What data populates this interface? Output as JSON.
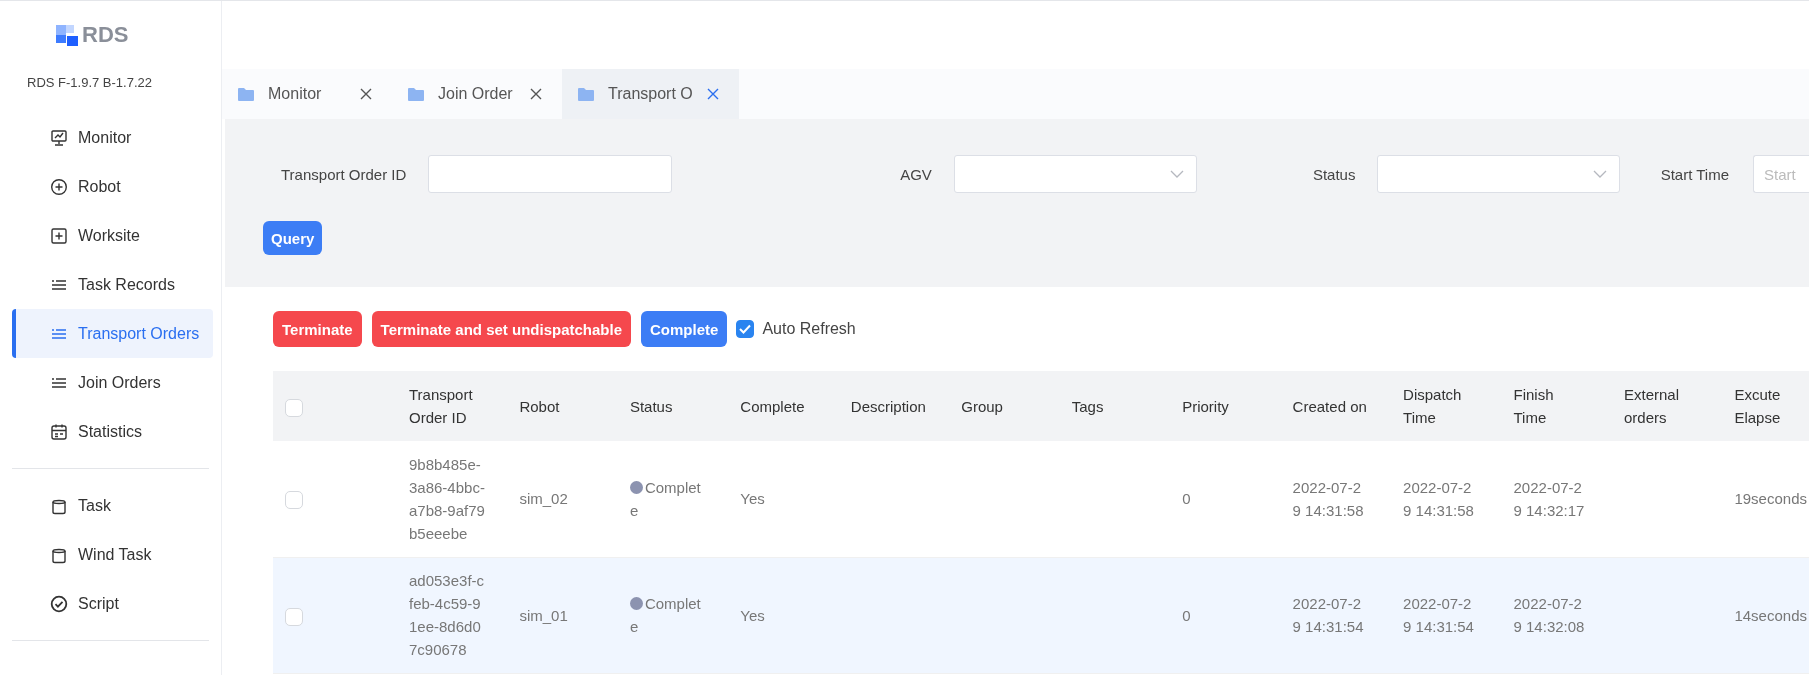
{
  "sidebar": {
    "logo": "RDS",
    "version": "RDS F-1.9.7 B-1.7.22",
    "groups": [
      [
        {
          "label": "Monitor",
          "kind": "monitor",
          "selected": false
        },
        {
          "label": "Robot",
          "kind": "addcircle",
          "selected": false
        },
        {
          "label": "Worksite",
          "kind": "addsquare",
          "selected": false
        },
        {
          "label": "Task Records",
          "kind": "list",
          "selected": false
        },
        {
          "label": "Transport Orders",
          "kind": "list",
          "selected": true
        },
        {
          "label": "Join Orders",
          "kind": "list",
          "selected": false
        },
        {
          "label": "Statistics",
          "kind": "calendar",
          "selected": false
        }
      ],
      [
        {
          "label": "Task",
          "kind": "storage",
          "selected": false
        },
        {
          "label": "Wind Task",
          "kind": "storage",
          "selected": false
        },
        {
          "label": "Script",
          "kind": "check",
          "selected": false
        }
      ]
    ]
  },
  "tabs": [
    {
      "label": "Monitor",
      "selected": false
    },
    {
      "label": "Join Order",
      "selected": false
    },
    {
      "label": "Transport O",
      "selected": true
    }
  ],
  "filters": [
    {
      "label": "Transport Order ID",
      "kind": "text"
    },
    {
      "label": "AGV",
      "kind": "select"
    },
    {
      "label": "Status",
      "kind": "select"
    },
    {
      "label": "Start Time",
      "kind": "date",
      "placeholder": "Start"
    }
  ],
  "query_button": "Query",
  "actions": [
    {
      "label": "Terminate",
      "kind": "danger"
    },
    {
      "label": "Terminate and set undispatchable",
      "kind": "danger"
    },
    {
      "label": "Complete",
      "kind": "primary"
    }
  ],
  "auto_refresh": {
    "label": "Auto Refresh",
    "checked": true
  },
  "table": {
    "select_all": {
      "checked": false
    },
    "columns": [
      "Transport Order ID",
      "Robot",
      "Status",
      "Complete",
      "Description",
      "Group",
      "Tags",
      "Priority",
      "Created on",
      "Dispatch Time",
      "Finish Time",
      "External orders",
      "Excute Elapse"
    ],
    "rows": [
      {
        "selected": false,
        "checked": false,
        "cells": [
          "9b8b485e-3a86-4bbc-a7b8-9af79b5eeebe",
          "sim_02",
          {
            "text": "Complete",
            "color": "#8c93b0"
          },
          "Yes",
          "",
          "",
          "",
          "0",
          "2022-07-29 14:31:58",
          "2022-07-29 14:31:58",
          "2022-07-29 14:32:17",
          "",
          "19seconds"
        ]
      },
      {
        "selected": true,
        "checked": false,
        "cells": [
          "ad053e3f-cfeb-4c59-91ee-8d6d07c90678",
          "sim_01",
          {
            "text": "Complete",
            "color": "#8c93b0"
          },
          "Yes",
          "",
          "",
          "",
          "0",
          "2022-07-29 14:31:54",
          "2022-07-29 14:31:54",
          "2022-07-29 14:32:08",
          "",
          "14seconds"
        ]
      }
    ]
  }
}
